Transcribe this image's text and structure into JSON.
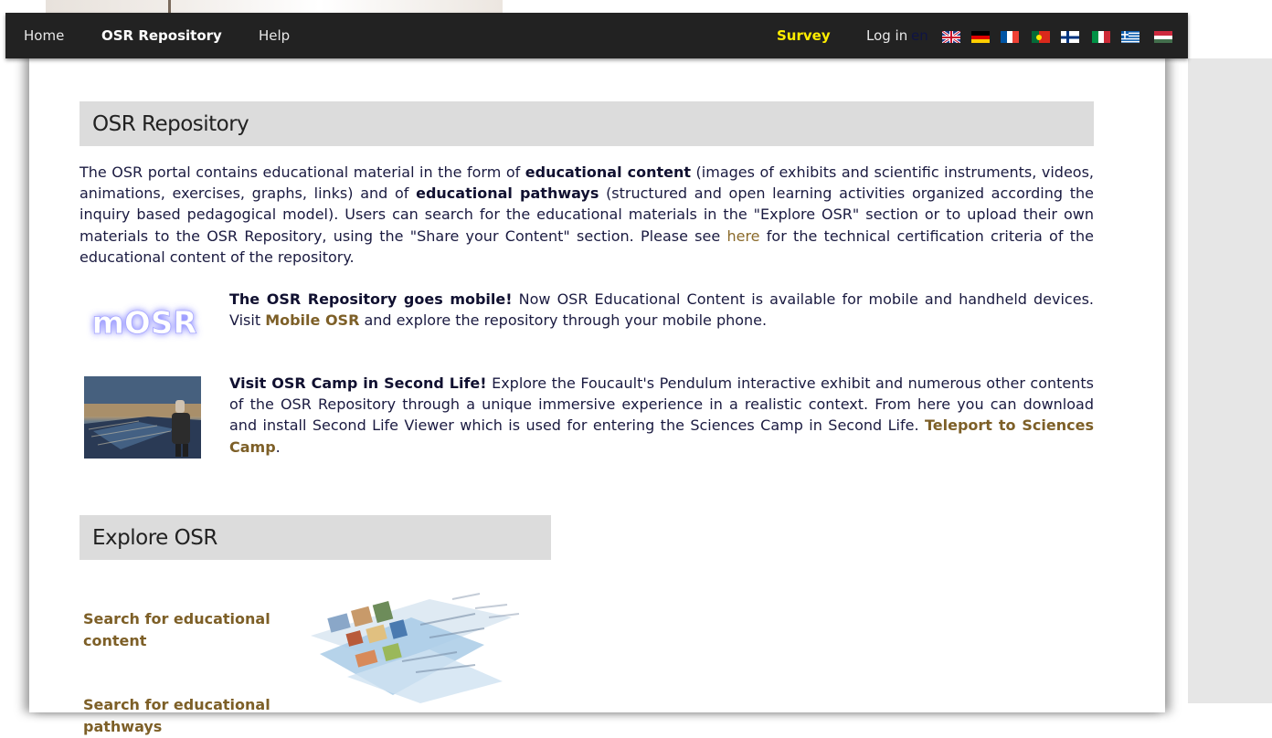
{
  "nav": {
    "home": "Home",
    "repository": "OSR Repository",
    "help": "Help",
    "survey": "Survey",
    "login": "Log in",
    "lang_code": "en",
    "flags": [
      "uk-flag",
      "german-flag",
      "french-flag",
      "portuguese-flag",
      "finnish-flag",
      "italian-flag",
      "greek-flag",
      "hungarian-flag"
    ]
  },
  "repository": {
    "title": "OSR Repository",
    "intro": {
      "t1": "The OSR portal contains educational material in the form of ",
      "b1": "educational content",
      "t2": " (images of exhibits and scientific instruments, videos, animations, exercises, graphs, links) and of ",
      "b2": "educational pathways",
      "t3": " (structured and open learning activities organized according the inquiry based pedagogical model). Users can search for the educational materials in the \"Explore OSR\" section or to upload their own materials to the OSR Repository, using the \"Share your Content\" section. Please see ",
      "here": "here",
      "t4": " for the technical certification criteria of the educational content of the repository."
    },
    "mobile": {
      "logo": "mOSR",
      "heading": "The OSR Repository goes mobile!",
      "t1": " Now OSR Educational Content is available for mobile and handheld devices. Visit ",
      "link": "Mobile OSR",
      "t2": " and explore the repository through your mobile phone."
    },
    "camp": {
      "heading": "Visit OSR Camp in Second Life!",
      "t1": " Explore the Foucault's Pendulum interactive exhibit and numerous other contents of the OSR Repository through a unique immersive experience in a realistic context. From here you can download and install Second Life Viewer which is used for entering the Sciences Camp in Second Life. ",
      "link": "Teleport to Sciences Camp",
      "t2": "."
    }
  },
  "explore": {
    "title": "Explore OSR",
    "search_content": "Search for educational content",
    "search_pathways": "Search for educational pathways"
  },
  "colors": {
    "navbar": "#222222",
    "survey": "#ffee00",
    "link": "#7d5f27",
    "section_header": "#dcdcdc"
  }
}
